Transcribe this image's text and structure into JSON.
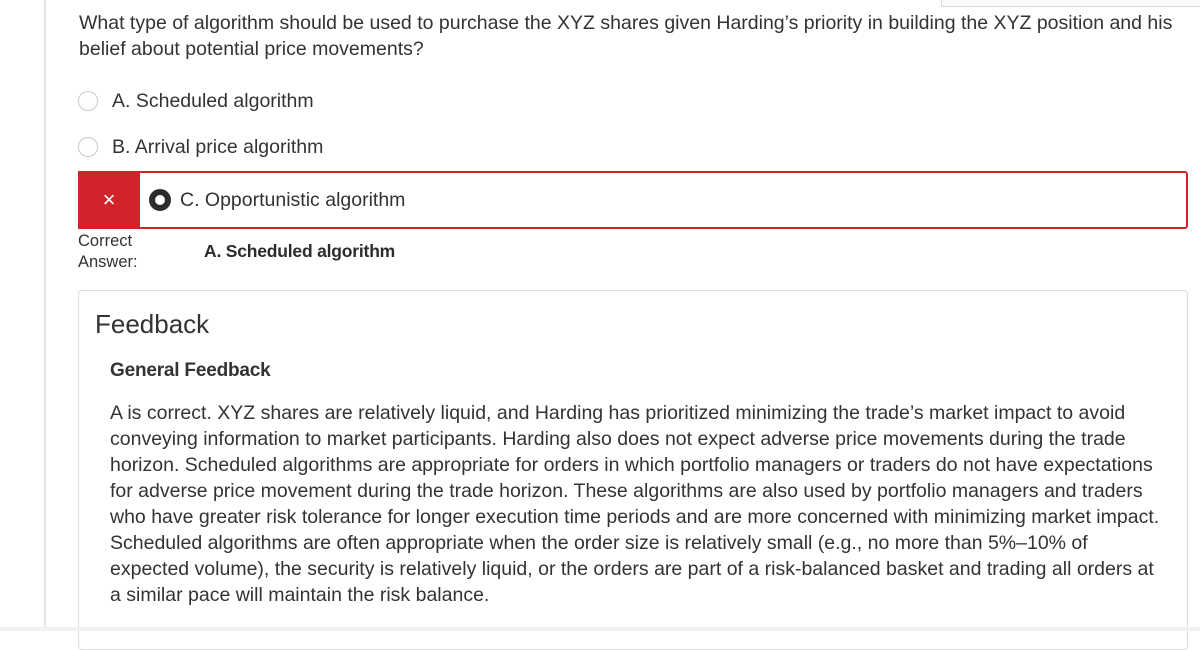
{
  "question": {
    "text": "What type of algorithm should be used to purchase the XYZ shares given Harding’s priority in building the XYZ position and his belief about potential price movements?"
  },
  "options": [
    {
      "label": "A. Scheduled algorithm"
    },
    {
      "label": "B. Arrival price algorithm"
    },
    {
      "label": "C. Opportunistic algorithm"
    }
  ],
  "result": {
    "incorrect_icon": "×",
    "correct_answer_label": "Correct Answer:",
    "correct_answer_value": "A. Scheduled algorithm"
  },
  "feedback": {
    "title": "Feedback",
    "general_title": "General Feedback",
    "general_text": "A is correct. XYZ shares are relatively liquid, and Harding has prioritized minimizing the trade’s market impact to avoid conveying information to market participants. Harding also does not expect adverse price movements during the trade horizon. Scheduled algorithms are appropriate for orders in which portfolio managers or traders do not have expectations for adverse price movement during the trade horizon. These algorithms are also used by portfolio managers and traders who have greater risk tolerance for longer execution time periods and are more concerned with minimizing market impact. Scheduled algorithms are often appropriate when the order size is relatively small (e.g., no more than 5%–10% of expected volume), the security is relatively liquid, or the orders are part of a risk-balanced basket and trading all orders at a similar pace will maintain the risk balance."
  },
  "colors": {
    "error_red": "#d2232a",
    "text": "#333333",
    "border": "#dcdcdc"
  }
}
